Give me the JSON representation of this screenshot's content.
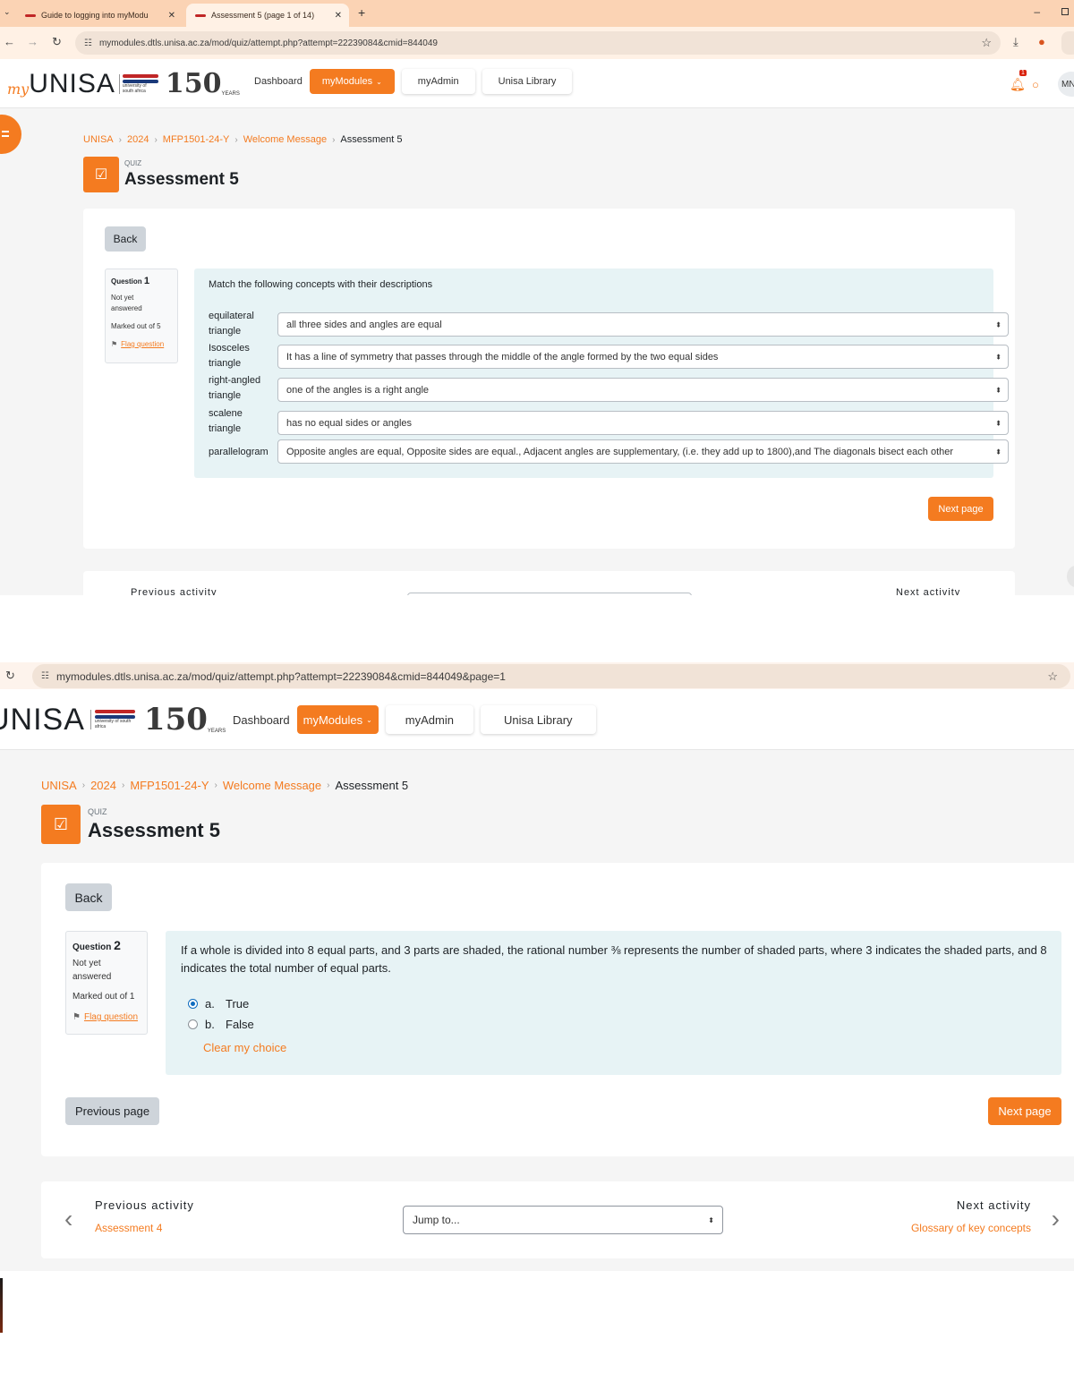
{
  "shot1": {
    "tabs": [
      {
        "title": "Guide to logging into myModu",
        "close": "✕"
      },
      {
        "title": "Assessment 5 (page 1 of 14)",
        "close": "✕"
      }
    ],
    "new_tab": "+",
    "url": "mymodules.dtls.unisa.ac.za/mod/quiz/attempt.php?attempt=22239084&cmid=844049",
    "notif_count": "1",
    "user_initials": "MN",
    "nav": {
      "dashboard": "Dashboard",
      "mymodules": "myModules",
      "myadmin": "myAdmin",
      "library": "Unisa Library"
    },
    "breadcrumb": [
      "UNISA",
      "2024",
      "MFP1501-24-Y",
      "Welcome Message",
      "Assessment 5"
    ],
    "kicker": "QUIZ",
    "title": "Assessment 5",
    "back": "Back",
    "question": {
      "label": "Question",
      "number": "1",
      "state": "Not yet answered",
      "marks": "Marked out of 5",
      "flag": "Flag question",
      "prompt": "Match the following concepts with their descriptions",
      "rows": [
        {
          "label": "equilateral triangle",
          "value": "all three sides and angles are equal"
        },
        {
          "label": "Isosceles triangle",
          "value": "It has a line of symmetry that passes through the middle of the angle formed by the two equal sides"
        },
        {
          "label": "right-angled triangle",
          "value": "one of the angles is a right angle"
        },
        {
          "label": "scalene triangle",
          "value": "has no equal sides or angles"
        },
        {
          "label": "parallelogram",
          "value": "Opposite angles are equal, Opposite sides are equal., Adjacent angles are supplementary, (i.e. they add up to 1800),and The diagonals bisect each other"
        }
      ]
    },
    "next_page": "Next page",
    "prev_activity": "Previous activity",
    "next_activity": "Next activity"
  },
  "shot2": {
    "url": "mymodules.dtls.unisa.ac.za/mod/quiz/attempt.php?attempt=22239084&cmid=844049&page=1",
    "nav": {
      "dashboard": "Dashboard",
      "mymodules": "myModules",
      "myadmin": "myAdmin",
      "library": "Unisa Library"
    },
    "breadcrumb": [
      "UNISA",
      "2024",
      "MFP1501-24-Y",
      "Welcome Message",
      "Assessment 5"
    ],
    "kicker": "QUIZ",
    "title": "Assessment 5",
    "back": "Back",
    "question": {
      "label": "Question",
      "number": "2",
      "state": "Not yet answered",
      "marks": "Marked out of 1",
      "flag": "Flag question",
      "prompt": "If a whole is divided into 8 equal parts, and 3 parts are shaded, the rational number ⅜ represents the number of shaded parts, where 3 indicates the shaded parts, and 8 indicates the total number of equal parts.",
      "answers": [
        {
          "letter": "a.",
          "text": "True",
          "selected": true
        },
        {
          "letter": "b.",
          "text": "False",
          "selected": false
        }
      ],
      "clear": "Clear my choice"
    },
    "prev_page": "Previous page",
    "next_page": "Next page",
    "activity_nav": {
      "prev_label": "Previous activity",
      "prev_link": "Assessment 4",
      "jump": "Jump to...",
      "next_label": "Next activity",
      "next_link": "Glossary of key concepts"
    }
  },
  "brand": {
    "my": "my",
    "unisa": "UNISA",
    "n150": "150",
    "years": "YEARS",
    "flag_small": "university of south africa"
  },
  "colors": {
    "accent": "#f47b20",
    "tabstrip": "#fbd3b4",
    "question_bg": "#e7f3f5",
    "radio_selected": "#0f6cbf"
  }
}
